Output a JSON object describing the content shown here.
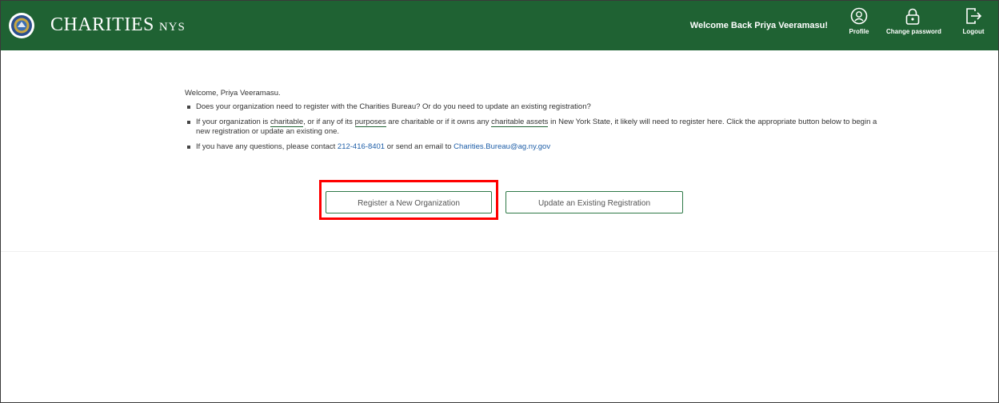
{
  "header": {
    "brand_name": "CHARITIES",
    "brand_suffix": "NYS",
    "welcome_back": "Welcome Back Priya Veeramasu!",
    "nav": {
      "profile_label": "Profile",
      "change_password_label": "Change password",
      "logout_label": "Logout"
    },
    "bar_color": "#1f6233"
  },
  "main": {
    "greeting": "Welcome, Priya Veeramasu.",
    "bullet1": "Does your organization need to register with the Charities Bureau? Or do you need to update an existing registration?",
    "bullet2": {
      "part1": "If your organization is ",
      "term1": "charitable",
      "part2": ", or if any of its ",
      "term2": "purposes",
      "part3": " are charitable or if it owns any ",
      "term3": "charitable assets",
      "part4": " in New York State, it likely will need to register here. Click the appropriate button below to begin a new registration or update an existing one."
    },
    "bullet3": {
      "part1": "If you have any questions, please contact ",
      "phone": "212-416-8401",
      "part2": " or send an email to ",
      "email": "Charities.Bureau@ag.ny.gov"
    },
    "buttons": {
      "register_label": "Register a New Organization",
      "update_label": "Update an Existing Registration"
    }
  },
  "annotation": {
    "highlight_color": "#ff0000"
  }
}
